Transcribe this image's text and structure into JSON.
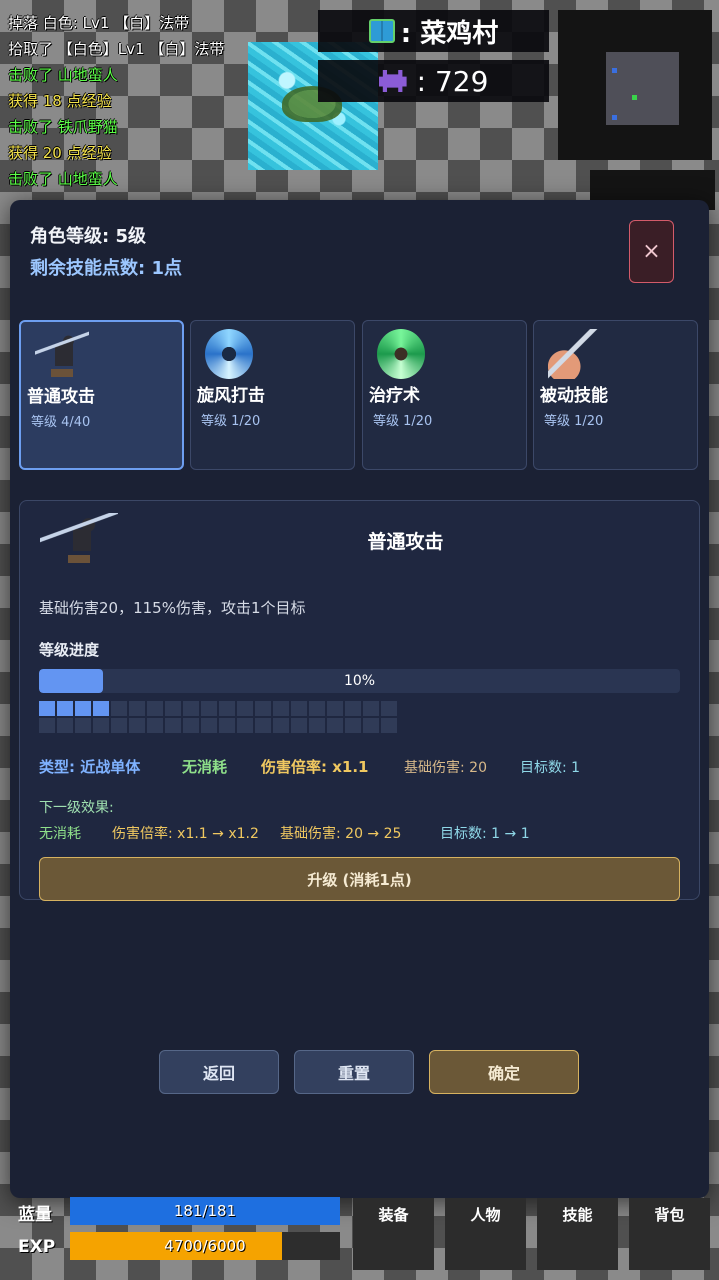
{
  "log": [
    {
      "text": "掉落 白色: Lv1 【白】法带",
      "color": "white"
    },
    {
      "text": "拾取了 【白色】Lv1 【白】法带",
      "color": "white"
    },
    {
      "text": "击败了 山地蛮人",
      "color": "green"
    },
    {
      "text": "获得 18 点经验",
      "color": "yellow"
    },
    {
      "text": "击败了 铁爪野猫",
      "color": "green"
    },
    {
      "text": "获得 20 点经验",
      "color": "yellow"
    },
    {
      "text": "击败了 山地蛮人",
      "color": "green"
    }
  ],
  "location": {
    "icon": "book-icon",
    "name": ": 菜鸡村"
  },
  "kills": {
    "icon": "invader-icon",
    "value": ":  729"
  },
  "skills_panel": {
    "char_level": "角色等级: 5级",
    "skill_points": "剩余技能点数: 1点",
    "close_label": "×",
    "cards": [
      {
        "name": "普通攻击",
        "level": "等级 4/40",
        "selected": true,
        "art": "ninja-slash"
      },
      {
        "name": "旋风打击",
        "level": "等级 1/20",
        "selected": false,
        "art": "whirlwind"
      },
      {
        "name": "治疗术",
        "level": "等级 1/20",
        "selected": false,
        "art": "heal"
      },
      {
        "name": "被动技能",
        "level": "等级 1/20",
        "selected": false,
        "art": "arm-sword"
      }
    ],
    "detail": {
      "title": "普通攻击",
      "description": "基础伤害20，115%伤害，攻击1个目标",
      "progress_label": "等级进度",
      "progress_value": 0.1,
      "progress_text": "10%",
      "segments_total": 40,
      "segments_filled": 4,
      "stats": {
        "type": "类型: 近战单体",
        "cost": "无消耗",
        "multiplier": "伤害倍率: x1.1",
        "base_damage": "基础伤害: 20",
        "targets": "目标数: 1"
      },
      "next_level_label": "下一级效果:",
      "next_level": {
        "cost": "无消耗",
        "multiplier": "伤害倍率: x1.1 → x1.2",
        "base_damage": "基础伤害: 20 → 25",
        "targets": "目标数: 1 → 1"
      },
      "upgrade_label": "升级 (消耗1点)"
    },
    "buttons": {
      "back": "返回",
      "reset": "重置",
      "confirm": "确定"
    }
  },
  "bars": {
    "mana": {
      "label": "蓝量",
      "text": "181/181",
      "value": 181,
      "max": 181,
      "color": "#1e6fe0"
    },
    "exp": {
      "label": "EXP",
      "text": "4700/6000",
      "value": 4700,
      "max": 6000,
      "color": "#f5a300"
    }
  },
  "menu": [
    "装备",
    "人物",
    "技能",
    "背包"
  ],
  "colors": {
    "accent": "#6395f2",
    "gold": "#d6b260",
    "type_blue": "#7fb2ff",
    "cost_green": "#8fe08a",
    "multiplier_yellow": "#f0c860",
    "base_tan": "#d8b98a",
    "targets_cyan": "#8fd8e8"
  }
}
